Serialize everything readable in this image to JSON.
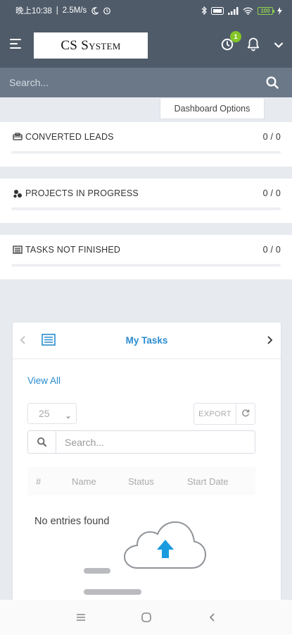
{
  "status_bar": {
    "time": "晚上10:38",
    "speed": "2.5M/s",
    "battery": "100"
  },
  "header": {
    "logo_text": "CS System",
    "timer_badge": "1",
    "icons": [
      "menu-icon",
      "timer-icon",
      "bell-icon",
      "chevron-down-icon"
    ]
  },
  "search": {
    "placeholder": "Search..."
  },
  "dashboard_options": {
    "label": "Dashboard Options"
  },
  "stats": [
    {
      "label": "CONVERTED LEADS",
      "value": "0 / 0",
      "icon": "converted-leads-icon",
      "progress": 0
    },
    {
      "label": "PROJECTS IN PROGRESS",
      "value": "0 / 0",
      "icon": "projects-icon",
      "progress": 0
    },
    {
      "label": "TASKS NOT FINISHED",
      "value": "0 / 0",
      "icon": "tasks-icon",
      "progress": 0
    }
  ],
  "tasks_widget": {
    "title": "My Tasks",
    "view_all": "View All",
    "page_length": "25",
    "export_label": "EXPORT",
    "search_placeholder": "Search...",
    "columns": [
      "#",
      "Name",
      "Status",
      "Start Date"
    ],
    "empty_text": "No entries found"
  },
  "colors": {
    "header_bg": "#4f5b69",
    "searchbar_bg": "#6b7888",
    "accent": "#2a8ccf",
    "badge": "#84c529",
    "page_bg": "#e7eaef"
  }
}
